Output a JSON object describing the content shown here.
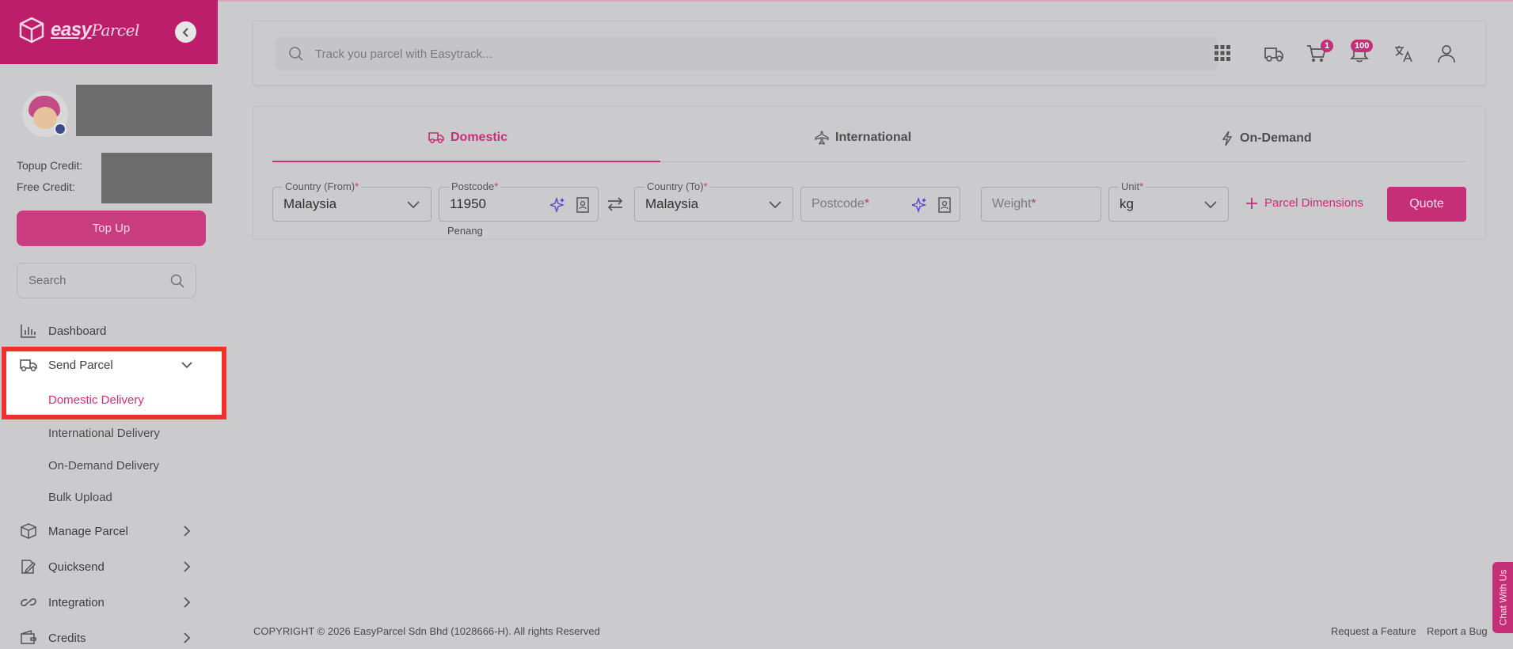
{
  "brand": {
    "name_part1": "easy",
    "name_part2": "Parcel",
    "accent": "#c62e77"
  },
  "sidebar": {
    "topup_credit_label": "Topup Credit:",
    "free_credit_label": "Free Credit:",
    "topup_button": "Top Up",
    "search_placeholder": "Search",
    "nav": [
      {
        "label": "Dashboard",
        "icon": "bar-chart-icon"
      },
      {
        "label": "Send Parcel",
        "icon": "truck-icon"
      },
      {
        "label": "Manage Parcel",
        "icon": "box-icon"
      },
      {
        "label": "Quicksend",
        "icon": "edit-icon"
      },
      {
        "label": "Integration",
        "icon": "link-icon"
      },
      {
        "label": "Credits",
        "icon": "wallet-icon"
      }
    ],
    "send_parcel_sub": [
      "Domestic Delivery",
      "International Delivery",
      "On-Demand Delivery",
      "Bulk Upload"
    ]
  },
  "topbar": {
    "track_placeholder": "Track you parcel with Easytrack...",
    "cart_count": "1",
    "notification_count": "100"
  },
  "quote": {
    "tabs": [
      "Domestic",
      "International",
      "On-Demand"
    ],
    "country_from_label": "Country (From)",
    "country_from_value": "Malaysia",
    "postcode_from_label": "Postcode",
    "postcode_from_value": "11950",
    "postcode_from_city": "Penang",
    "country_to_label": "Country (To)",
    "country_to_value": "Malaysia",
    "postcode_to_placeholder": "Postcode",
    "weight_placeholder": "Weight",
    "unit_label": "Unit",
    "unit_value": "kg",
    "required_mark": "*",
    "parcel_dimensions": "Parcel Dimensions",
    "quote_button": "Quote"
  },
  "footer": {
    "copyright": "COPYRIGHT © 2026 EasyParcel Sdn Bhd (1028666-H). All rights Reserved",
    "request_feature": "Request a Feature",
    "report_bug": "Report a Bug"
  },
  "chat": {
    "label": "Chat With Us"
  }
}
